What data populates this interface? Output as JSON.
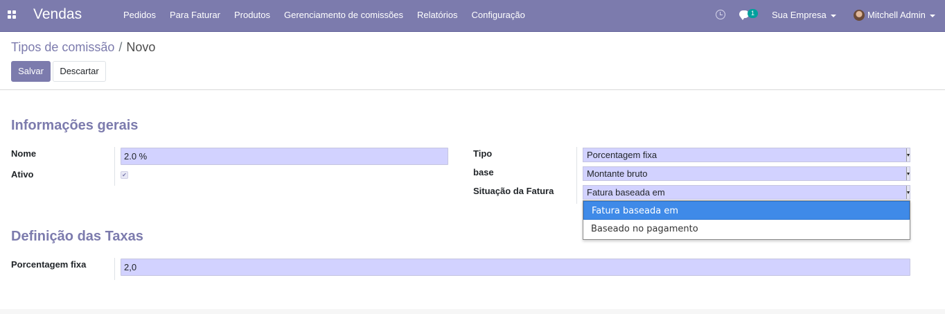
{
  "navbar": {
    "brand": "Vendas",
    "menu": [
      "Pedidos",
      "Para Faturar",
      "Produtos",
      "Gerenciamento de comissões",
      "Relatórios",
      "Configuração"
    ],
    "chat_badge": "1",
    "company": "Sua Empresa",
    "user": "Mitchell Admin"
  },
  "breadcrumb": {
    "parent": "Tipos de comissão",
    "separator": "/",
    "current": "Novo"
  },
  "buttons": {
    "save": "Salvar",
    "discard": "Descartar"
  },
  "form": {
    "general_title": "Informações gerais",
    "name_label": "Nome",
    "name_value": "2.0 %",
    "active_label": "Ativo",
    "active_checked": true,
    "active_mark": "✔",
    "type_label": "Tipo",
    "type_value": "Porcentagem fixa",
    "base_label": "base",
    "base_value": "Montante bruto",
    "invoice_state_label": "Situação da Fatura",
    "invoice_state_value": "Fatura baseada em",
    "invoice_state_options": [
      "Fatura baseada em",
      "Baseado no pagamento"
    ],
    "rates_title": "Definição das Taxas",
    "fixed_pct_label": "Porcentagem fixa",
    "fixed_pct_value": "2,0"
  },
  "colors": {
    "navbar": "#7c7bad",
    "accent": "#7c7bad",
    "field_bg": "#d2d2ff",
    "dropdown_selected": "#3f8ae8",
    "badge": "#00a09d"
  }
}
